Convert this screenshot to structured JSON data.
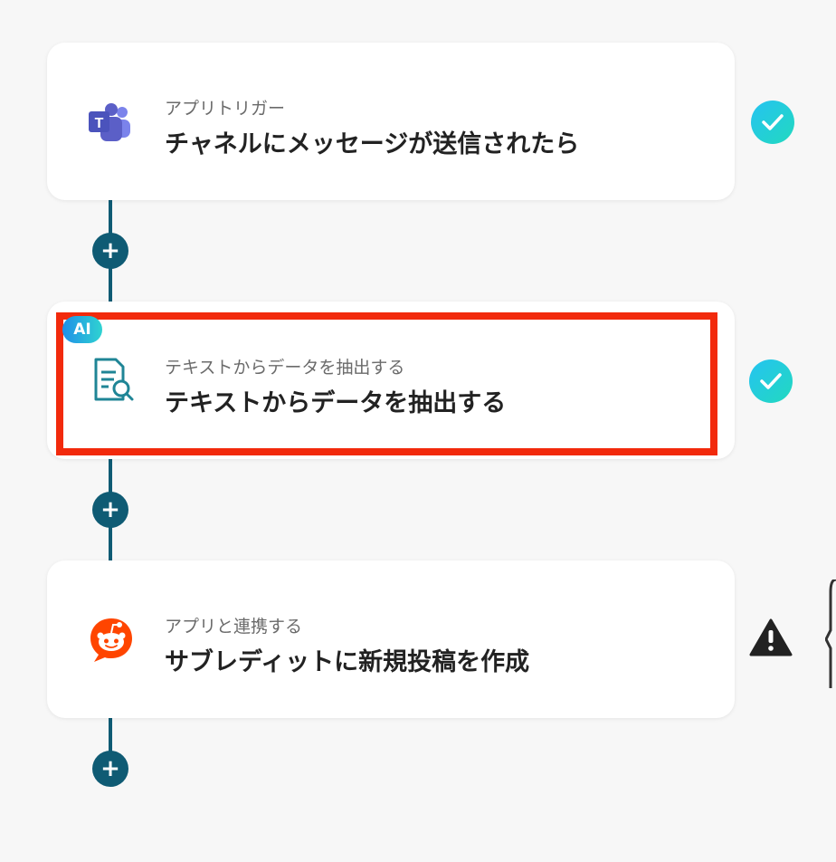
{
  "steps": [
    {
      "subtitle": "アプリトリガー",
      "title": "チャネルにメッセージが送信されたら",
      "status": "completed",
      "icon": "microsoft-teams-icon"
    },
    {
      "subtitle": "テキストからデータを抽出する",
      "title": "テキストからデータを抽出する",
      "badge": "AI",
      "status": "completed",
      "icon": "document-search-icon",
      "highlighted": true
    },
    {
      "subtitle": "アプリと連携する",
      "title": "サブレディットに新規投稿を作成",
      "status": "warning",
      "icon": "reddit-icon"
    }
  ],
  "add_button_label": "+",
  "colors": {
    "connector": "#0f5b74",
    "highlight": "#f22a0c",
    "check_gradient_start": "#25c3f1",
    "check_gradient_end": "#22d9bf",
    "reddit": "#ff4500",
    "teams": "#5b5fc7"
  }
}
